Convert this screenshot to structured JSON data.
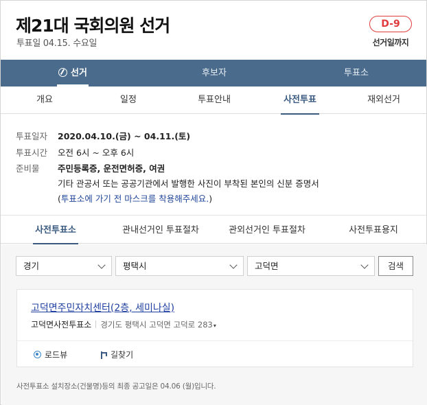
{
  "header": {
    "title": "제21대 국회의원 선거",
    "vote_date": "투표일 04.15. 수요일",
    "dday": "D-9",
    "dday_caption": "선거일까지"
  },
  "main_nav": {
    "items": [
      {
        "label": "선거",
        "active": true
      },
      {
        "label": "후보자",
        "active": false
      },
      {
        "label": "투표소",
        "active": false
      }
    ]
  },
  "sub_tabs": [
    "개요",
    "일정",
    "투표안내",
    "사전투표",
    "재외선거"
  ],
  "sub_tab_active": "사전투표",
  "info": {
    "date_label": "투표일자",
    "date_value": "2020.04.10.(금) ~ 04.11.(토)",
    "time_label": "투표시간",
    "time_value": "오전 6시 ~ 오후 6시",
    "prep_label": "준비물",
    "prep_value": "주민등록증, 운전면허증, 여권",
    "prep_note": "기타 관공서 또는 공공기관에서 발행한 사진이 부착된 본인의 신분 증명서",
    "mask_open": "(",
    "mask_text": "투표소에 가기 전 마스크를 착용해주세요.",
    "mask_close": ")"
  },
  "early_tabs": [
    "사전투표소",
    "관내선거인 투표절차",
    "관외선거인 투표절차",
    "사전투표용지"
  ],
  "early_tab_active": "사전투표소",
  "search": {
    "province": "경기",
    "city": "평택시",
    "town": "고덕면",
    "button": "검색"
  },
  "result": {
    "place_name": "고덕면주민자치센터(2층, 세미나실)",
    "station": "고덕면사전투표소",
    "address": "경기도 평택시 고덕면 고덕로 283",
    "expand_icon": "▾",
    "roadview": "로드뷰",
    "directions": "길찾기"
  },
  "footnote": "사전투표소 설치장소(건물명)등의 최종 공고일은 04.06 (월)입니다."
}
